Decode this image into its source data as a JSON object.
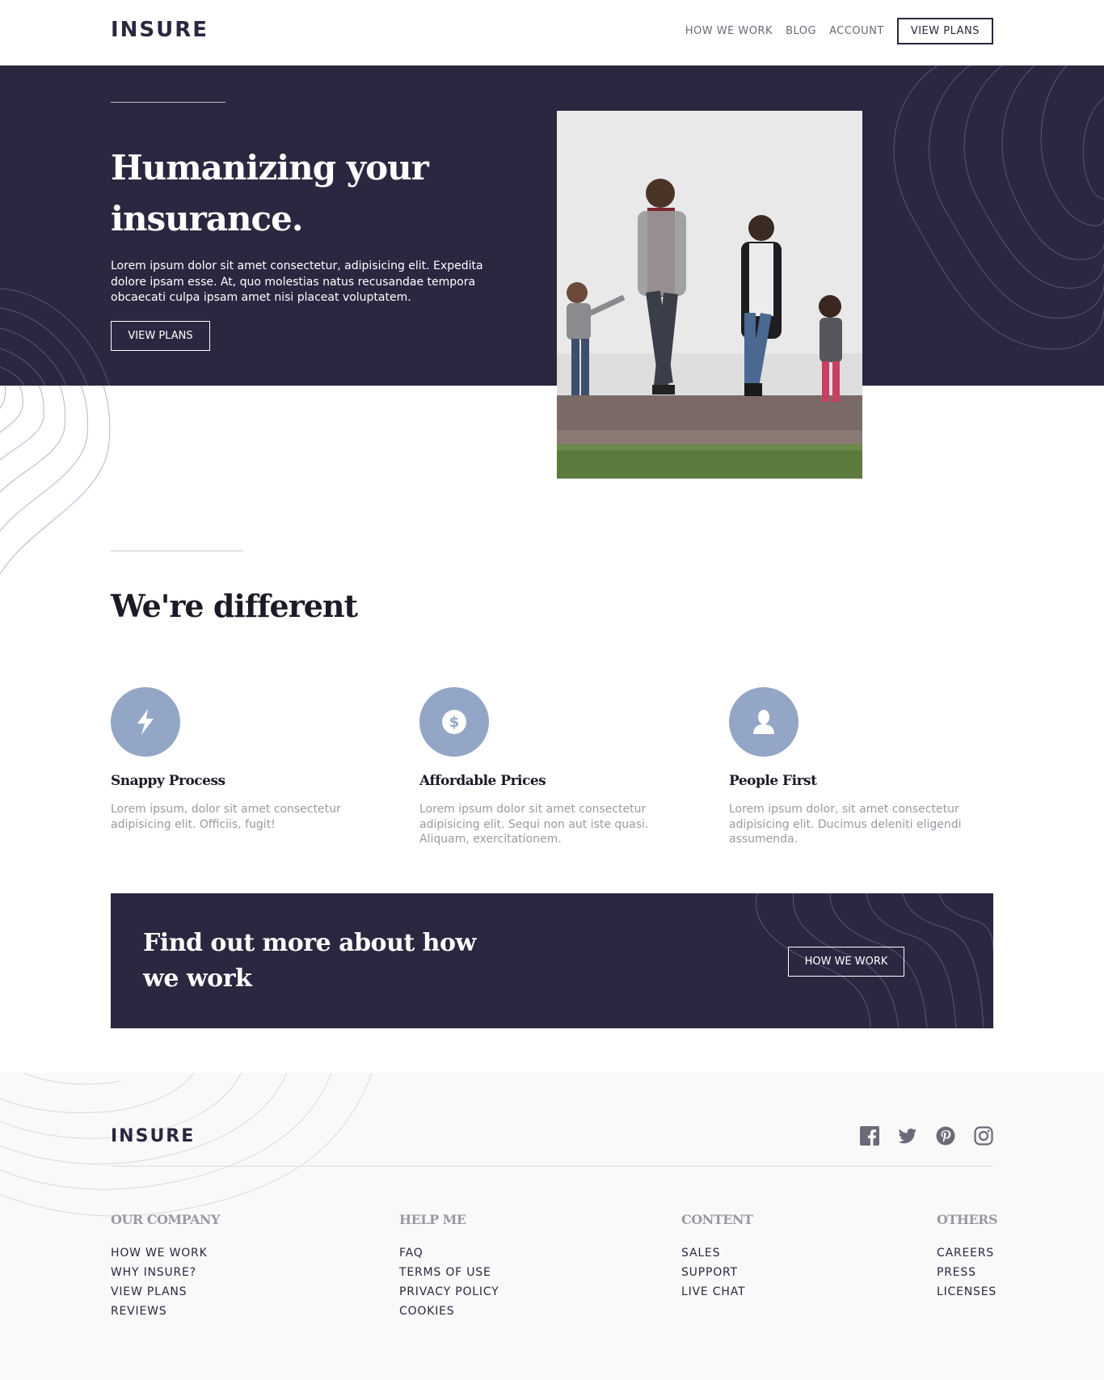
{
  "header": {
    "logo": "INSURE",
    "nav": [
      "HOW WE WORK",
      "BLOG",
      "ACCOUNT"
    ],
    "cta": "VIEW PLANS"
  },
  "hero": {
    "title": "Humanizing your insurance.",
    "text": "Lorem ipsum dolor sit amet consectetur, adipisicing elit. Expedita dolore ipsam esse. At, quo molestias natus recusandae tempora obcaecati culpa ipsam amet nisi placeat voluptatem.",
    "button": "VIEW PLANS"
  },
  "different": {
    "title": "We're different",
    "features": [
      {
        "icon": "lightning-icon",
        "title": "Snappy Process",
        "text": "Lorem ipsum, dolor sit amet consectetur adipisicing elit. Officiis, fugit!"
      },
      {
        "icon": "dollar-icon",
        "title": "Affordable Prices",
        "text": "Lorem ipsum dolor sit amet consectetur adipisicing elit. Sequi non aut iste quasi. Aliquam, exercitationem."
      },
      {
        "icon": "person-icon",
        "title": "People First",
        "text": "Lorem ipsum dolor, sit amet consectetur adipisicing elit. Ducimus deleniti eligendi assumenda."
      }
    ]
  },
  "cta": {
    "title": "Find out more about how we work",
    "button": "HOW WE WORK"
  },
  "footer": {
    "logo": "INSURE",
    "social": [
      "facebook-icon",
      "twitter-icon",
      "pinterest-icon",
      "instagram-icon"
    ],
    "columns": [
      {
        "title": "OUR COMPANY",
        "links": [
          "HOW WE WORK",
          "WHY INSURE?",
          "VIEW PLANS",
          "REVIEWS"
        ]
      },
      {
        "title": "HELP ME",
        "links": [
          "FAQ",
          "TERMS OF USE",
          "PRIVACY POLICY",
          "COOKIES"
        ]
      },
      {
        "title": "CONTENT",
        "links": [
          "SALES",
          "SUPPORT",
          "LIVE CHAT"
        ]
      },
      {
        "title": "OTHERS",
        "links": [
          "CAREERS",
          "PRESS",
          "LICENSES"
        ]
      }
    ]
  },
  "colors": {
    "dark_violet": "#2d2640",
    "icon_circle": "#93a6c6",
    "muted_text": "#9a99a3",
    "footer_bg": "#f9f9f9"
  }
}
